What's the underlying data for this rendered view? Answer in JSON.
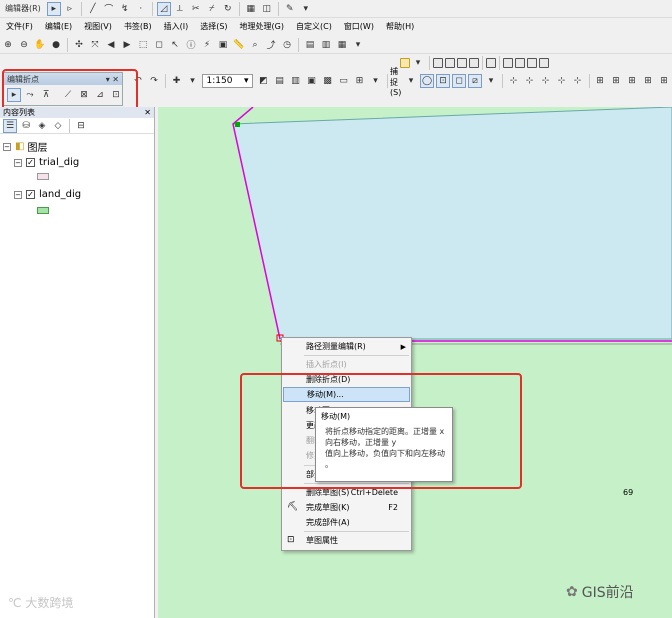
{
  "toolbar1": {
    "editor_menu": "编辑器(R)"
  },
  "menubar": {
    "items": [
      "文件(F)",
      "编辑(E)",
      "视图(V)",
      "书签(B)",
      "插入(I)",
      "选择(S)",
      "地理处理(G)",
      "自定义(C)",
      "窗口(W)",
      "帮助(H)"
    ]
  },
  "standard": {
    "scale": "1:150",
    "snapping_label": "捕捉(S)"
  },
  "edit_vertices_toolbar": {
    "title": "编辑折点"
  },
  "toc": {
    "title": "内容列表",
    "root": "图层",
    "layers": [
      {
        "name": "trial_dig",
        "swatch": "#f7e1ea"
      },
      {
        "name": "land_dig",
        "swatch": "#a6e3a6"
      }
    ]
  },
  "map": {
    "bg": "#c6f0c7",
    "parcel_fill": "#cce8f0",
    "label_69": "69"
  },
  "context_menu": {
    "items": [
      {
        "label": "路径测量编辑(R)",
        "submenu": true
      },
      {
        "label": "插入折点(I)",
        "disabled": true
      },
      {
        "label": "删除折点(D)"
      },
      {
        "label": "移动(M)...",
        "highlighted": true
      },
      {
        "label": "移动至(T)..."
      },
      {
        "label": "更改..."
      },
      {
        "label": "翻转",
        "disabled": true
      },
      {
        "label": "修剪...",
        "disabled": true
      },
      {
        "label": "部分..."
      },
      {
        "label": "删除草图(S)",
        "shortcut": "Ctrl+Delete"
      },
      {
        "label": "完成草图(K)",
        "shortcut": "F2"
      },
      {
        "label": "完成部件(A)"
      },
      {
        "label": "草图属性"
      }
    ]
  },
  "tooltip": {
    "title": "移动(M)",
    "lines": [
      "将折点移动指定的距离。正增量 x",
      "向右移动，正增量 y",
      "值向上移动，负值向下和向左移动",
      "。"
    ]
  },
  "watermark": {
    "left": "大数跨境",
    "right": "GIS前沿"
  }
}
